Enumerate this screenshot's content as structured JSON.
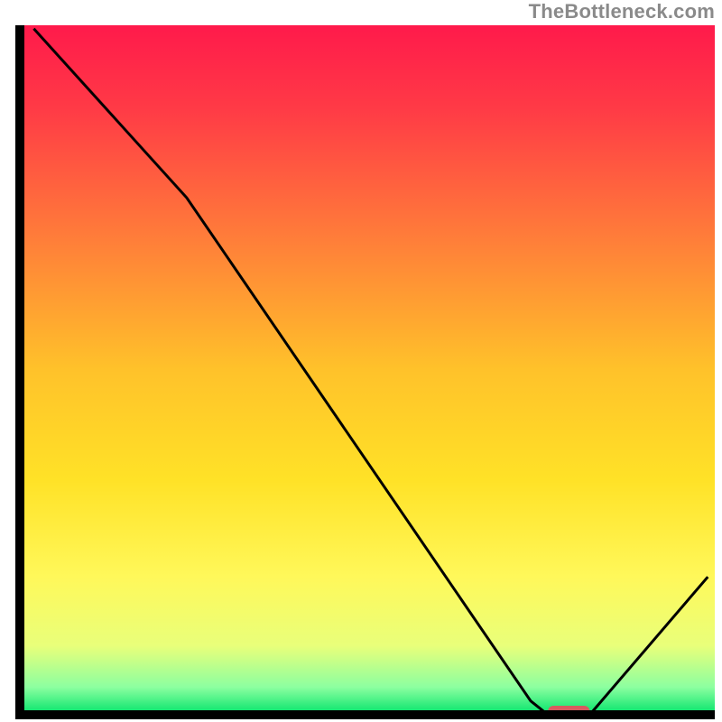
{
  "watermark": "TheBottleneck.com",
  "chart_data": {
    "type": "line",
    "title": "",
    "xlabel": "",
    "ylabel": "",
    "xlim": [
      0,
      100
    ],
    "ylim": [
      0,
      100
    ],
    "x": [
      2,
      24,
      73.5,
      76,
      82,
      99
    ],
    "values": [
      99.5,
      75,
      2,
      0,
      0,
      20
    ],
    "marker": {
      "x_start": 76,
      "x_end": 82,
      "y": 0
    },
    "gradient_stops": [
      {
        "pct": 0,
        "color": "#ff1a4b"
      },
      {
        "pct": 12,
        "color": "#ff3a46"
      },
      {
        "pct": 30,
        "color": "#ff7a3a"
      },
      {
        "pct": 50,
        "color": "#ffc22a"
      },
      {
        "pct": 66,
        "color": "#ffe227"
      },
      {
        "pct": 80,
        "color": "#fff85a"
      },
      {
        "pct": 90,
        "color": "#e9ff7a"
      },
      {
        "pct": 96,
        "color": "#8cffa0"
      },
      {
        "pct": 100,
        "color": "#00e36a"
      }
    ]
  },
  "geometry": {
    "plot_left": 22,
    "plot_top": 28,
    "plot_right": 792,
    "plot_bottom": 792,
    "axis_stroke": 10,
    "curve_stroke": 3
  }
}
